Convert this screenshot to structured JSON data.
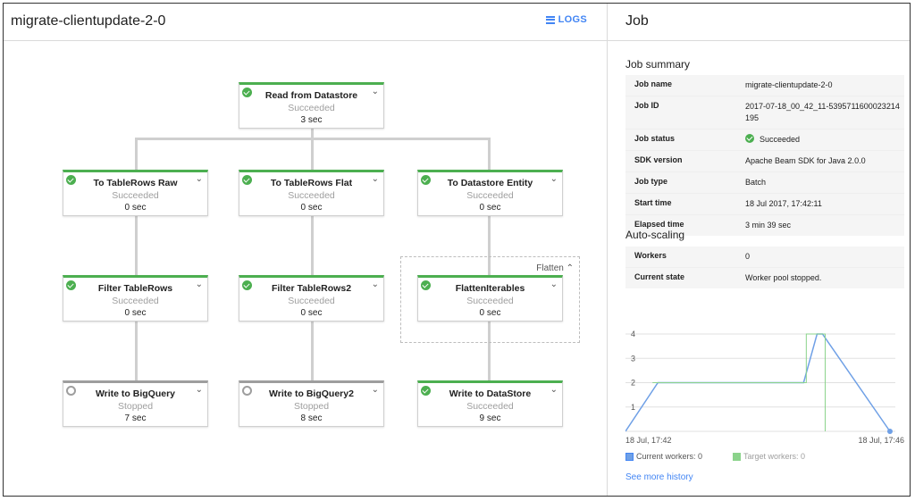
{
  "header": {
    "title": "migrate-clientupdate-2-0",
    "logs_label": "LOGS"
  },
  "graph": {
    "nodes": [
      {
        "name": "Read from Datastore",
        "status": "Succeeded",
        "time": "3 sec"
      },
      {
        "name": "To TableRows Raw",
        "status": "Succeeded",
        "time": "0 sec"
      },
      {
        "name": "To TableRows Flat",
        "status": "Succeeded",
        "time": "0 sec"
      },
      {
        "name": "To Datastore Entity",
        "status": "Succeeded",
        "time": "0 sec"
      },
      {
        "name": "Filter TableRows",
        "status": "Succeeded",
        "time": "0 sec"
      },
      {
        "name": "Filter TableRows2",
        "status": "Succeeded",
        "time": "0 sec"
      },
      {
        "name": "FlattenIterables",
        "status": "Succeeded",
        "time": "0 sec"
      },
      {
        "name": "Write to BigQuery",
        "status": "Stopped",
        "time": "7 sec"
      },
      {
        "name": "Write to BigQuery2",
        "status": "Stopped",
        "time": "8 sec"
      },
      {
        "name": "Write to DataStore",
        "status": "Succeeded",
        "time": "9 sec"
      }
    ],
    "flatten_label": "Flatten",
    "colors": {
      "succeeded": "#4caf50",
      "stopped": "#9e9e9e"
    }
  },
  "job": {
    "title": "Job",
    "summary_heading": "Job summary",
    "summary": [
      {
        "key": "Job name",
        "value": "migrate-clientupdate-2-0"
      },
      {
        "key": "Job ID",
        "value": "2017-07-18_00_42_11-5395711600023214195"
      },
      {
        "key": "Job status",
        "value": "Succeeded"
      },
      {
        "key": "SDK version",
        "value": "Apache Beam SDK for Java 2.0.0"
      },
      {
        "key": "Job type",
        "value": "Batch"
      },
      {
        "key": "Start time",
        "value": "18 Jul 2017, 17:42:11"
      },
      {
        "key": "Elapsed time",
        "value": "3 min 39 sec"
      }
    ],
    "autoscaling_heading": "Auto-scaling",
    "autoscaling": [
      {
        "key": "Workers",
        "value": "0"
      },
      {
        "key": "Current state",
        "value": "Worker pool stopped."
      }
    ],
    "legend": {
      "current": "Current workers: 0",
      "target": "Target workers: 0"
    },
    "more_link": "See more history"
  },
  "chart_data": {
    "type": "line",
    "x_tick_labels": [
      "18 Jul, 17:42",
      "18 Jul, 17:46"
    ],
    "y_ticks": [
      1,
      2,
      3,
      4
    ],
    "ylim": [
      0,
      4
    ],
    "series": [
      {
        "name": "Current workers",
        "color": "#6fa0e6",
        "points": [
          {
            "t": 0,
            "y": 0
          },
          {
            "t": 0.12,
            "y": 2
          },
          {
            "t": 0.66,
            "y": 2
          },
          {
            "t": 0.71,
            "y": 4
          },
          {
            "t": 0.73,
            "y": 4
          },
          {
            "t": 0.98,
            "y": 0
          }
        ]
      },
      {
        "name": "Target workers",
        "color": "#8bd38b",
        "points": [
          {
            "t": 0.1,
            "y": 2
          },
          {
            "t": 0.67,
            "y": 2
          },
          {
            "t": 0.67,
            "y": 4
          },
          {
            "t": 0.74,
            "y": 4
          },
          {
            "t": 0.74,
            "y": 0
          }
        ]
      }
    ]
  }
}
